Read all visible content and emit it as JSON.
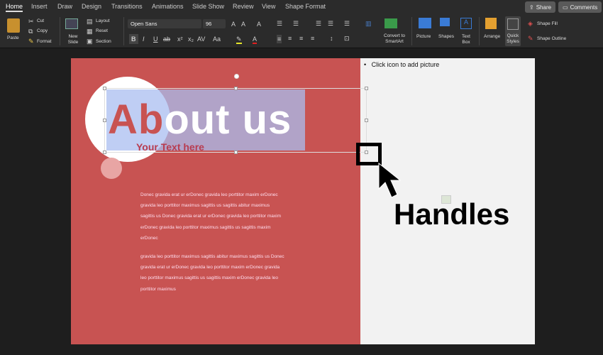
{
  "tabs": [
    "Home",
    "Insert",
    "Draw",
    "Design",
    "Transitions",
    "Animations",
    "Slide Show",
    "Review",
    "View",
    "Shape Format"
  ],
  "share_label": "Share",
  "comments_label": "Comments",
  "clipboard": {
    "paste": "Paste",
    "cut": "Cut",
    "copy": "Copy",
    "format": "Format"
  },
  "slides": {
    "new_slide": "New Slide",
    "layout": "Layout",
    "reset": "Reset",
    "section": "Section"
  },
  "font": {
    "name": "Open Sans",
    "size": "96"
  },
  "convert": "Convert to SmartArt",
  "insert": {
    "picture": "Picture",
    "shapes": "Shapes",
    "text_box": "Text Box"
  },
  "arrange": {
    "arrange": "Arrange",
    "quick_styles": "Quick Styles",
    "shape_fill": "Shape Fill",
    "shape_outline": "Shape Outline"
  },
  "slide": {
    "title": "About us",
    "subtitle": "Your Text here",
    "placeholder": "Click icon to add picture",
    "annotation": "Handles",
    "para1": "Donec gravida erat ur erDonec gravida leo porttitor maxim erDonec gravida leo porttitor maximus sagittis us sagittis abitur maximus sagittis us  Donec gravida erat ur erDonec gravida leo porttitor maxim erDonec gravida leo porttitor maximus sagittis us sagittis maxim erDonec",
    "para2": " gravida leo porttitor maximus sagittis abitur maximus sagittis us Donec gravida erat ur erDonec gravida leo porttitor maxim erDonec gravida leo porttitor maximus sagittis us sagittis maxim erDonec gravida leo porttitor maximus"
  },
  "colors": {
    "slide_red": "#c85352",
    "highlight": "#b9b6d9"
  }
}
